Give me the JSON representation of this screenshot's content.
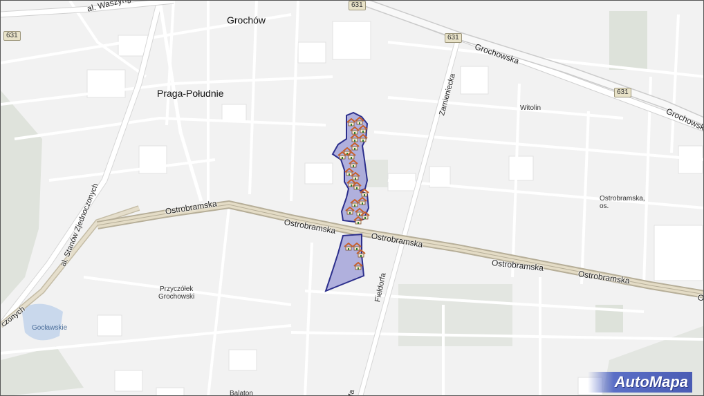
{
  "map": {
    "districts": [
      "Grochów",
      "Praga-Południe"
    ],
    "places": [
      "Witolin",
      "Ostrobramska,\nos.",
      "Przyczółek\nGrochowski",
      "Balaton"
    ],
    "water": [
      "Gocławskie"
    ],
    "road_shields": [
      "631",
      "631",
      "631",
      "631"
    ],
    "roads": {
      "was": "al. Waszyngtona",
      "grochowska1": "Grochowska",
      "grochowska2": "Grochowska",
      "zamieniecka": "Zamieniecka",
      "ostrobramska1": "Ostrobramska",
      "ostrobramska2": "Ostrobramska",
      "ostrobramska3": "Ostrobramska",
      "ostrobramska4": "Ostrobramska",
      "ostrobramska5": "Ostrobramska",
      "ostrobramska6": "Ostrobramska",
      "stanow": "al. Stanów Zjednoczonych",
      "stanow_end": "czonych",
      "fieldorfa": "Fieldorfa",
      "fieldorfa_end": "rfa"
    },
    "highlight_color": "#9a9ad6",
    "highlight_stroke": "#2c2f8c",
    "icon": "house-icon"
  },
  "brand": {
    "label": "AutoMapa"
  }
}
